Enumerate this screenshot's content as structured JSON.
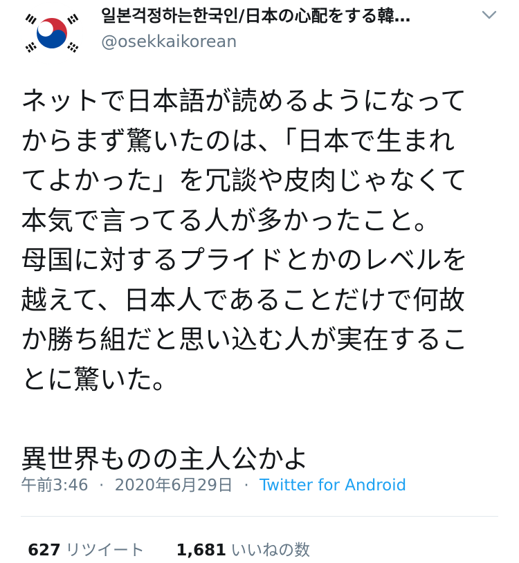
{
  "header": {
    "display_name": "일본걱정하는한국인/日本の心配をする韓…",
    "handle": "@osekkaikorean",
    "avatar_icon": "korean-flag-icon",
    "menu_icon": "chevron-down-icon"
  },
  "tweet": {
    "lines": [
      "ネットで日本語が読めるようになって",
      "からまず驚いたのは、「日本で生まれ",
      "てよかった」を冗談や皮肉じゃなくて",
      "本気で言ってる人が多かったこと。",
      "母国に対するプライドとかのレベルを",
      "越えて、日本人であることだけで何故",
      "か勝ち組だと思い込む人が実在するこ",
      "とに驚いた。",
      "",
      "異世界ものの主人公かよ"
    ]
  },
  "meta": {
    "time": "午前3:46",
    "date": "2020年6月29日",
    "separator": "·",
    "source": "Twitter for Android"
  },
  "stats": {
    "retweets_count": "627",
    "retweets_label": "リツイート",
    "likes_count": "1,681",
    "likes_label": "いいねの数"
  },
  "colors": {
    "text": "#14171a",
    "muted": "#657786",
    "link": "#1da1f2",
    "divider": "#e1e8ed"
  }
}
